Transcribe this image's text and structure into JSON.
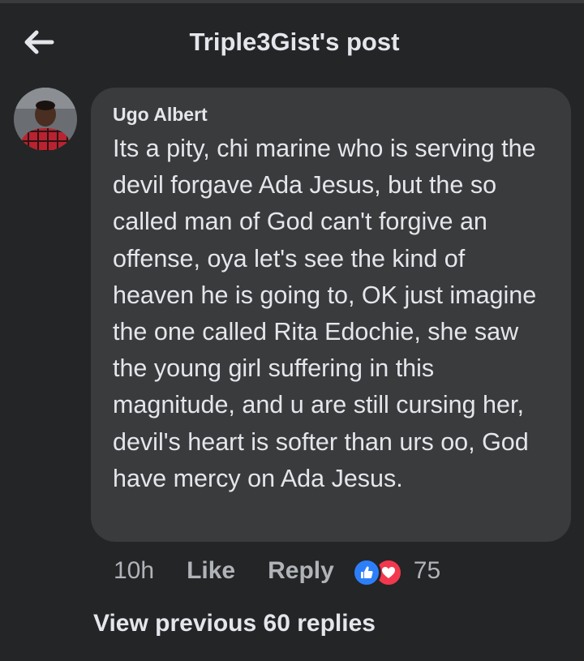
{
  "header": {
    "title": "Triple3Gist's post"
  },
  "comment": {
    "author": "Ugo Albert",
    "text": "Its a pity, chi marine who is serving the devil forgave Ada Jesus, but the so called man of God can't forgive an offense, oya let's see the kind of heaven he is going to, OK just imagine the one called Rita Edochie, she saw the young girl suffering in this magnitude, and u are still cursing her, devil's heart is softer than urs oo, God have mercy on Ada Jesus.",
    "time": "10h",
    "like_label": "Like",
    "reply_label": "Reply",
    "reaction_count": "75",
    "reactions": [
      "like-icon",
      "love-icon"
    ]
  },
  "replies": {
    "view_previous_label": "View previous 60 replies"
  },
  "colors": {
    "background": "#242526",
    "bubble": "#3a3b3c",
    "like_blue": "#2d7ff9",
    "love_red": "#f2384f",
    "secondary_text": "#b0b3b8"
  }
}
